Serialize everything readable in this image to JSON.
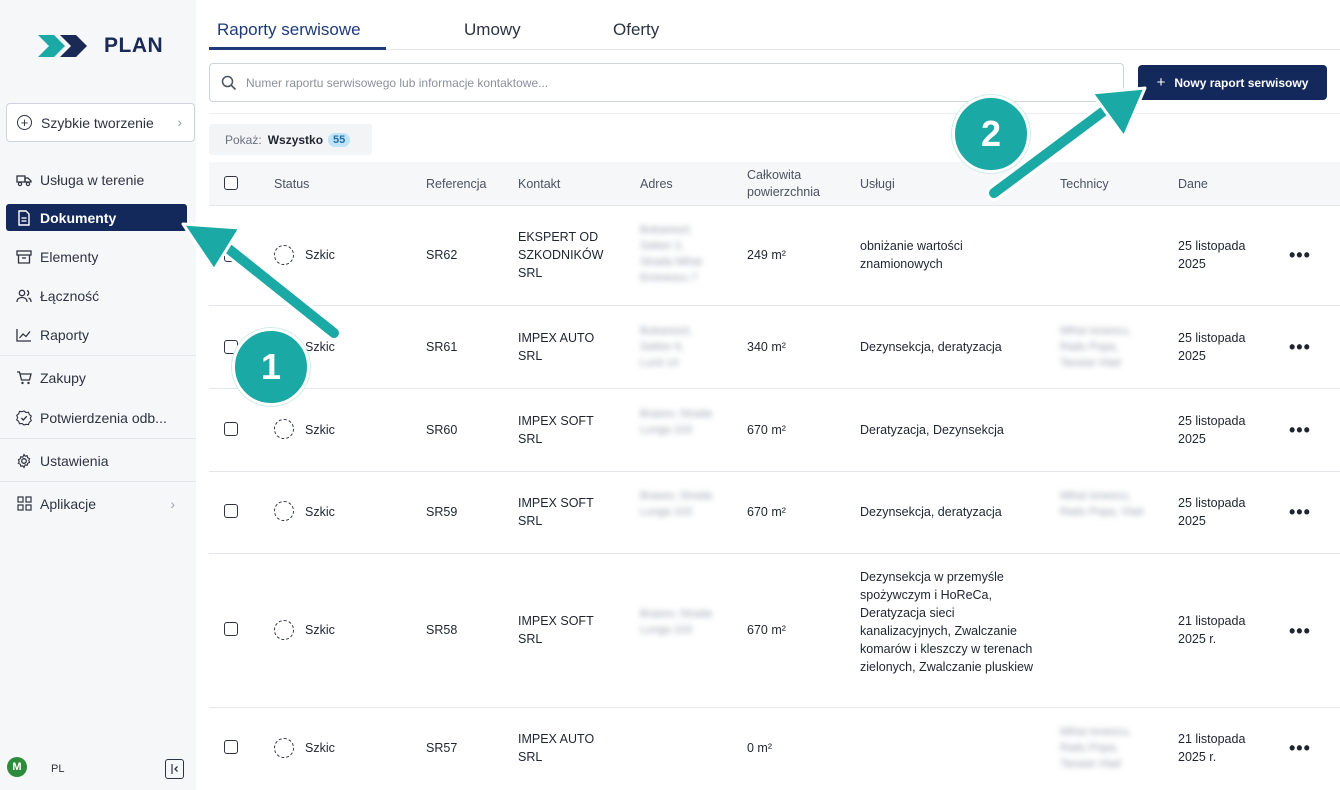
{
  "app": {
    "logo_text": "PLAN"
  },
  "sidebar": {
    "quick_create": "Szybkie tworzenie",
    "items": [
      {
        "label": "Usługa w terenie",
        "icon": "truck-icon",
        "active": false
      },
      {
        "label": "Dokumenty",
        "icon": "document-icon",
        "active": true
      },
      {
        "label": "Elementy",
        "icon": "archive-icon",
        "active": false
      },
      {
        "label": "Łączność",
        "icon": "users-icon",
        "active": false
      },
      {
        "label": "Raporty",
        "icon": "chart-line-icon",
        "active": false
      },
      {
        "label": "Zakupy",
        "icon": "cart-icon",
        "active": false
      },
      {
        "label": "Potwierdzenia odb...",
        "icon": "badge-check-icon",
        "active": false
      },
      {
        "label": "Ustawienia",
        "icon": "gear-icon",
        "active": false
      },
      {
        "label": "Aplikacje",
        "icon": "apps-grid-icon",
        "active": false
      }
    ],
    "user_initial": "M",
    "language": "PL"
  },
  "tabs": [
    {
      "label": "Raporty serwisowe",
      "active": true
    },
    {
      "label": "Umowy",
      "active": false
    },
    {
      "label": "Oferty",
      "active": false
    }
  ],
  "search": {
    "placeholder": "Numer raportu serwisowego lub informacje kontaktowe...",
    "value": ""
  },
  "new_button": "Nowy raport serwisowy",
  "filter": {
    "label": "Pokaż:",
    "value": "Wszystko",
    "count": "55"
  },
  "table": {
    "columns": [
      "Status",
      "Referencja",
      "Kontakt",
      "Adres",
      "Całkowita powierzchnia",
      "Usługi",
      "Technicy",
      "Dane"
    ],
    "rows": [
      {
        "status": "Szkic",
        "ref": "SR62",
        "contact": "EKSPERT OD SZKODNIKÓW SRL",
        "address": "Bukareszt, Sektor 2, Strada Mihai Eminescu 7",
        "area": "249 m²",
        "services": "obniżanie wartości znamionowych",
        "technicians": "",
        "date": "25 listopada 2025"
      },
      {
        "status": "Szkic",
        "ref": "SR61",
        "contact": "IMPEX AUTO SRL",
        "address": "Bukareszt, Sektor 6, Lunii 14",
        "area": "340 m²",
        "services": "Dezynsekcja, deratyzacja",
        "technicians": "Mihai Ionescu, Radu Popa, Tanase Vlad",
        "date": "25 listopada 2025"
      },
      {
        "status": "Szkic",
        "ref": "SR60",
        "contact": "IMPEX SOFT SRL",
        "address": "Brasov, Strada Lunga 103",
        "area": "670 m²",
        "services": "Deratyzacja, Dezynsekcja",
        "technicians": "",
        "date": "25 listopada 2025"
      },
      {
        "status": "Szkic",
        "ref": "SR59",
        "contact": "IMPEX SOFT SRL",
        "address": "Brasov, Strada Lunga 103",
        "area": "670 m²",
        "services": "Dezynsekcja, deratyzacja",
        "technicians": "Mihai Ionescu, Radu Popa, Vlad",
        "date": "25 listopada 2025"
      },
      {
        "status": "Szkic",
        "ref": "SR58",
        "contact": "IMPEX SOFT SRL",
        "address": "Brasov, Strada Lunga 103",
        "area": "670 m²",
        "services": "Dezynsekcja w przemyśle spożywczym i HoReCa, Deratyzacja sieci kanalizacyjnych, Zwalczanie komarów i kleszczy w terenach zielonych, Zwalczanie pluskiew",
        "technicians": "",
        "date": "21 listopada 2025 r."
      },
      {
        "status": "Szkic",
        "ref": "SR57",
        "contact": "IMPEX AUTO SRL",
        "address": "",
        "area": "0 m²",
        "services": "",
        "technicians": "Mihai Ionescu, Radu Popa, Tanase Vlad",
        "date": "21 listopada 2025 r."
      }
    ]
  },
  "annotations": {
    "step1": "1",
    "step2": "2",
    "color": "#1aa9a4"
  }
}
